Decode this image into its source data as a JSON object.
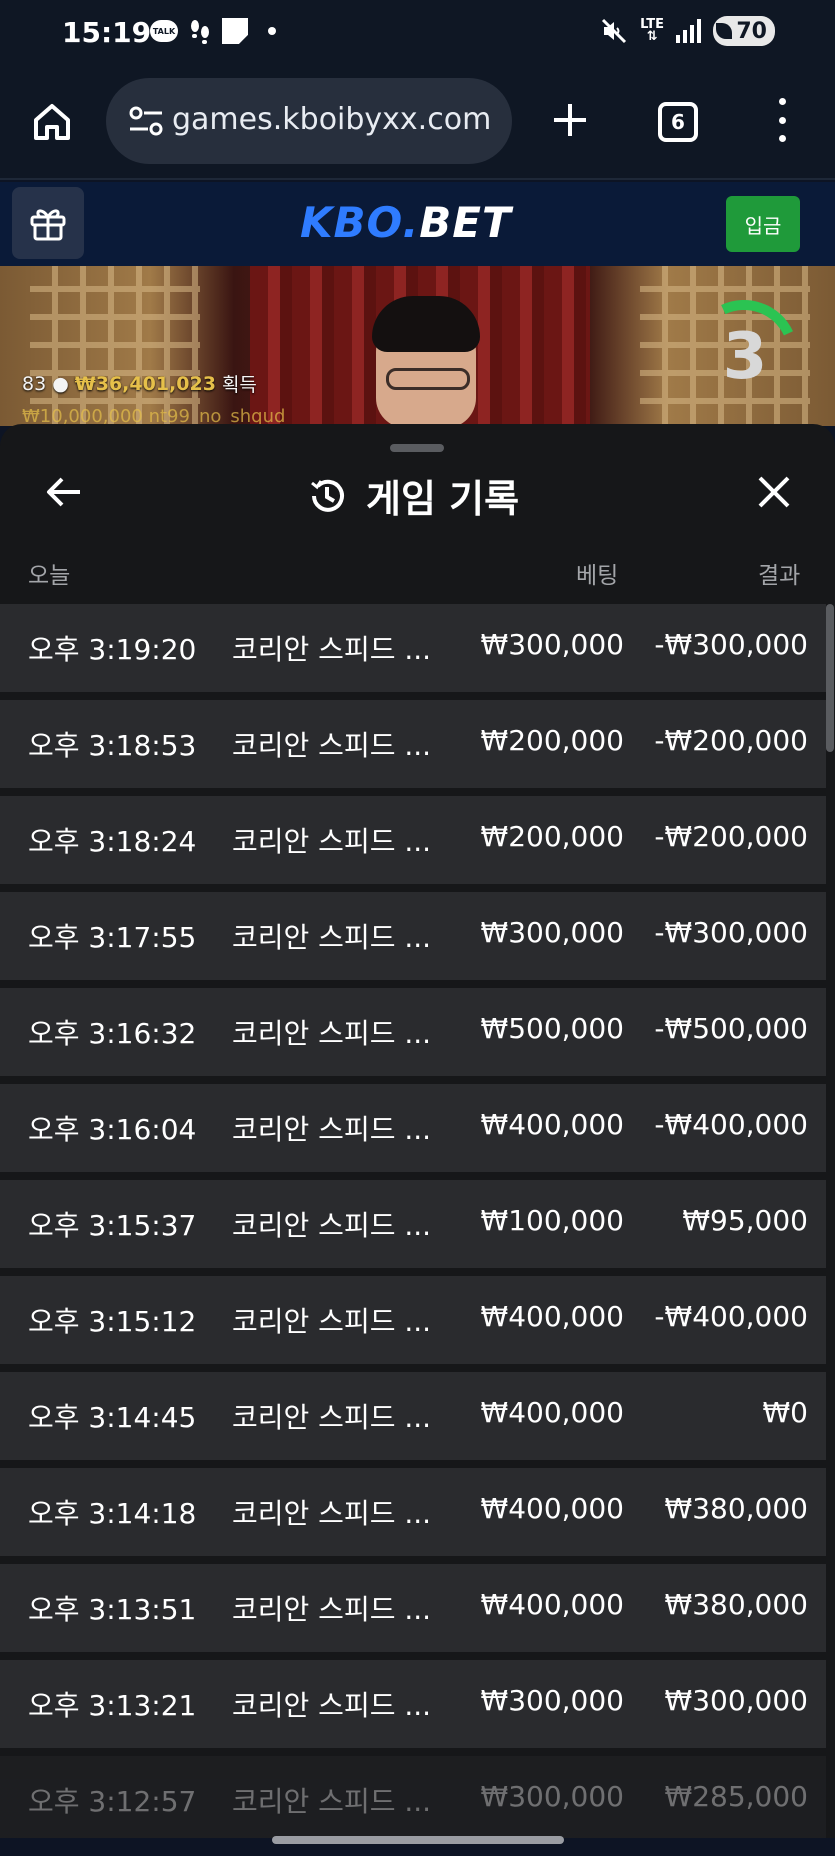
{
  "status_bar": {
    "time": "15:19",
    "talk_label": "TALK",
    "network": "LTE",
    "battery": "70"
  },
  "browser": {
    "url": "games.kboibyxx.com",
    "tab_count": "6"
  },
  "site": {
    "logo_part1": "KBO.",
    "logo_part2": "BET",
    "deposit_label": "입금",
    "accent": "#2f7cff",
    "deposit_color": "#1f9a3a"
  },
  "video": {
    "viewers": "83",
    "payout": "₩36,401,023",
    "payout_suffix": "획득",
    "sub_line": "₩10,000,000 nt99_no_shqud",
    "countdown": "3"
  },
  "panel": {
    "title": "게임 기록",
    "col_date": "오늘",
    "col_bet": "베팅",
    "col_result": "결과",
    "rows": [
      {
        "time": "오후 3:19:20",
        "game": "코리안 스피드 ...",
        "bet": "₩300,000",
        "result": "-₩300,000"
      },
      {
        "time": "오후 3:18:53",
        "game": "코리안 스피드 ...",
        "bet": "₩200,000",
        "result": "-₩200,000"
      },
      {
        "time": "오후 3:18:24",
        "game": "코리안 스피드 ...",
        "bet": "₩200,000",
        "result": "-₩200,000"
      },
      {
        "time": "오후 3:17:55",
        "game": "코리안 스피드 ...",
        "bet": "₩300,000",
        "result": "-₩300,000"
      },
      {
        "time": "오후 3:16:32",
        "game": "코리안 스피드 ...",
        "bet": "₩500,000",
        "result": "-₩500,000"
      },
      {
        "time": "오후 3:16:04",
        "game": "코리안 스피드 ...",
        "bet": "₩400,000",
        "result": "-₩400,000"
      },
      {
        "time": "오후 3:15:37",
        "game": "코리안 스피드 ...",
        "bet": "₩100,000",
        "result": "₩95,000"
      },
      {
        "time": "오후 3:15:12",
        "game": "코리안 스피드 ...",
        "bet": "₩400,000",
        "result": "-₩400,000"
      },
      {
        "time": "오후 3:14:45",
        "game": "코리안 스피드 ...",
        "bet": "₩400,000",
        "result": "₩0"
      },
      {
        "time": "오후 3:14:18",
        "game": "코리안 스피드 ...",
        "bet": "₩400,000",
        "result": "₩380,000"
      },
      {
        "time": "오후 3:13:51",
        "game": "코리안 스피드 ...",
        "bet": "₩400,000",
        "result": "₩380,000"
      },
      {
        "time": "오후 3:13:21",
        "game": "코리안 스피드 ...",
        "bet": "₩300,000",
        "result": "₩300,000"
      },
      {
        "time": "오후 3:12:57",
        "game": "코리안 스피드 ...",
        "bet": "₩300,000",
        "result": "₩285,000"
      }
    ]
  }
}
